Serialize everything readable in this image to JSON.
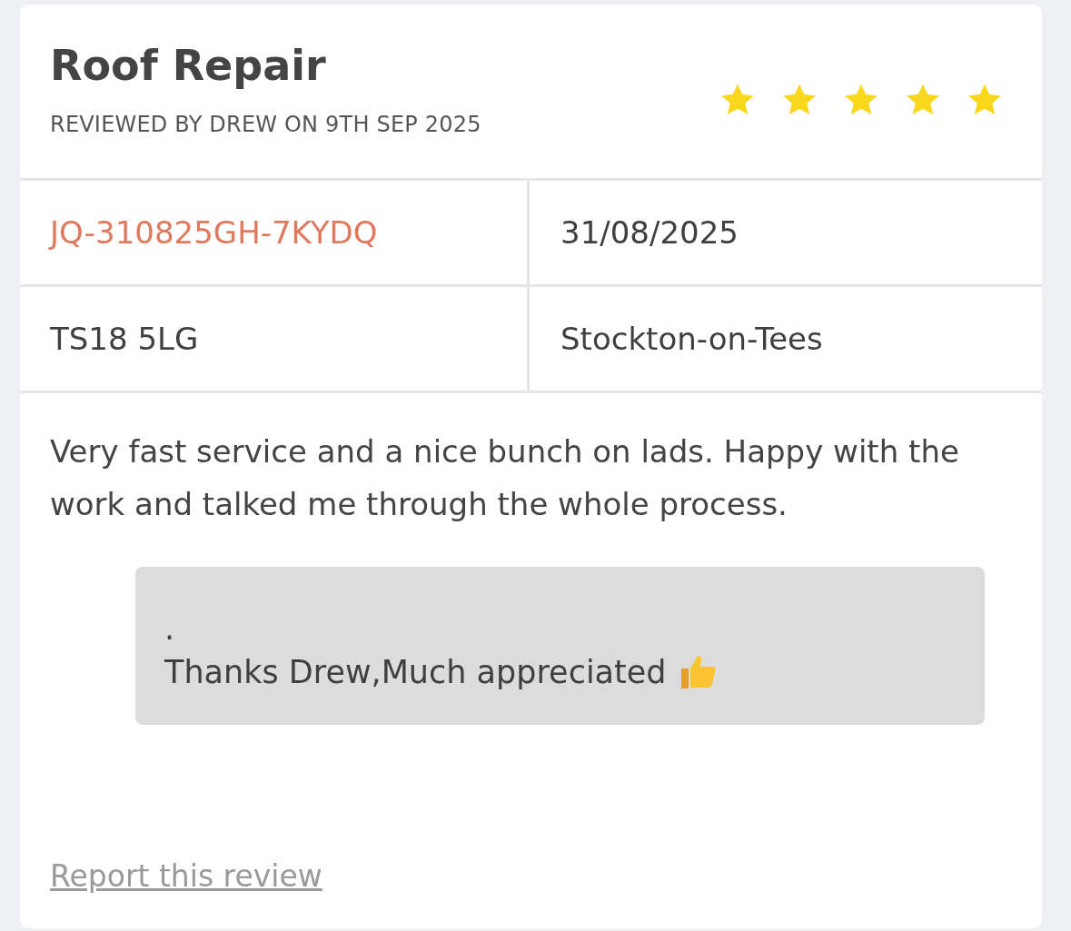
{
  "review": {
    "title": "Roof Repair",
    "subtitle": "REVIEWED BY DREW ON 9TH SEP 2025",
    "stars": 5,
    "details": [
      {
        "kind": "reference",
        "text": "JQ-310825GH-7KYDQ"
      },
      {
        "kind": "plain",
        "text": "31/08/2025"
      },
      {
        "kind": "plain",
        "text": "TS18 5LG"
      },
      {
        "kind": "plain",
        "text": "Stockton-on-Tees"
      }
    ],
    "comment": "Very fast service and a nice bunch on lads. Happy with the work and talked me through the whole process.",
    "reply": {
      "lines": [
        ".",
        "Thanks Drew,Much appreciated"
      ]
    },
    "report_link": "Report this review"
  }
}
